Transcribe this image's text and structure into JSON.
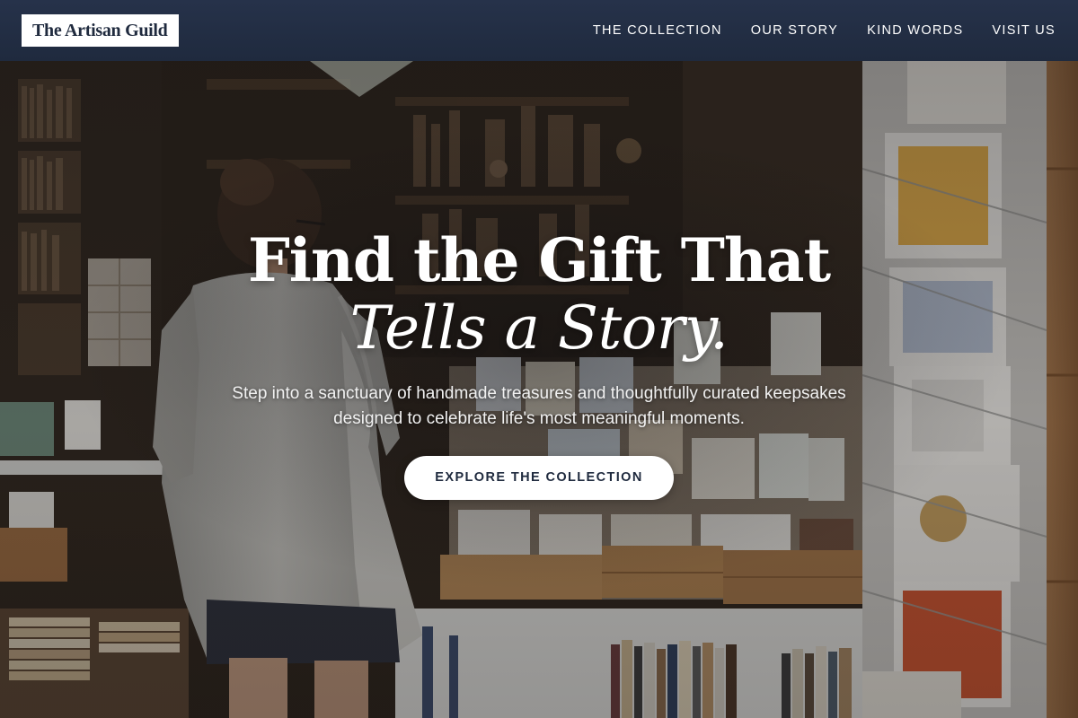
{
  "header": {
    "logo_text": "The Artisan Guild",
    "nav": [
      {
        "label": "THE COLLECTION"
      },
      {
        "label": "OUR STORY"
      },
      {
        "label": "KIND WORDS"
      },
      {
        "label": "VISIT US"
      }
    ]
  },
  "hero": {
    "headline_line1": "Find the Gift That",
    "headline_line2": "Tells a Story.",
    "subtitle": "Step into a sanctuary of handmade treasures and thoughtfully curated keepsakes designed to celebrate life's most meaningful moments.",
    "cta_label": "EXPLORE THE COLLECTION",
    "background_description": "bookshop-interior-photo"
  },
  "colors": {
    "header_bg": "#1f2a3e",
    "logo_bg": "#ffffff",
    "logo_text": "#1f2a3e",
    "nav_text": "#ffffff",
    "cta_bg": "#ffffff",
    "cta_text": "#1f2a3e",
    "headline_text": "#ffffff"
  }
}
